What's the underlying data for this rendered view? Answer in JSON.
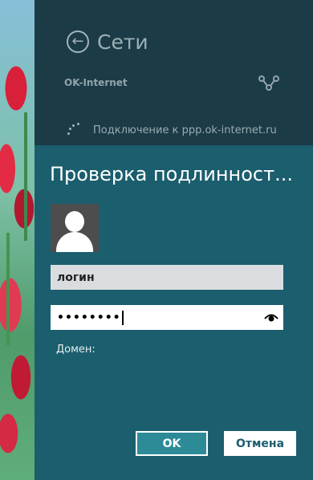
{
  "networks": {
    "title": "Сети",
    "network_name": "OK-Internet",
    "connecting_text": "Подключение к ppp.ok-internet.ru"
  },
  "auth_dialog": {
    "title": "Проверка подлинност...",
    "login_value": "логин",
    "password_mask": "••••••••",
    "domain_label": "Домен:",
    "ok_label": "OK",
    "cancel_label": "Отмена"
  },
  "icons": {
    "back": "back-arrow-icon",
    "signal": "signal-icon",
    "spinner": "spinner-icon",
    "user": "user-avatar-icon",
    "reveal": "eye-icon"
  },
  "colors": {
    "dialog_bg": "#1b5e6e",
    "panel_bg": "#1b3b47",
    "ok_button": "#2d8b98"
  }
}
